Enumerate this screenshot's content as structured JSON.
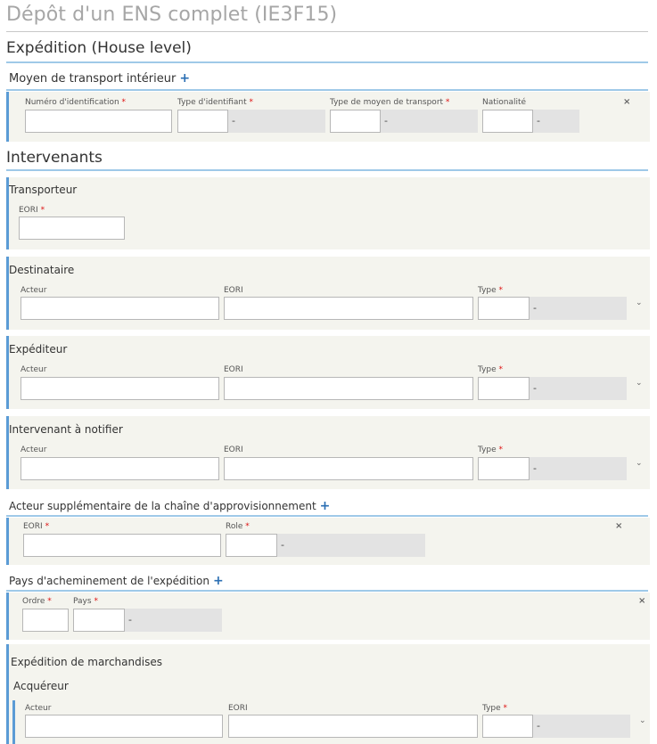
{
  "page": {
    "title": "Dépôt d'un ENS complet (IE3F15)"
  },
  "expedition": {
    "title": "Expédition (House level)",
    "transport": {
      "title": "Moyen de transport intérieur",
      "add": "+",
      "labels": {
        "numero": "Numéro d'identification",
        "type_id": "Type d'identifiant",
        "type_moyen": "Type de moyen de transport",
        "nationalite": "Nationalité"
      },
      "dash": "-",
      "close": "×"
    }
  },
  "intervenants": {
    "title": "Intervenants",
    "transporteur": {
      "title": "Transporteur",
      "eori_label": "EORI"
    },
    "destinataire": {
      "title": "Destinataire",
      "acteur": "Acteur",
      "eori": "EORI",
      "type": "Type",
      "dash": "-"
    },
    "expediteur": {
      "title": "Expéditeur",
      "acteur": "Acteur",
      "eori": "EORI",
      "type": "Type",
      "dash": "-"
    },
    "notifier": {
      "title": "Intervenant à notifier",
      "acteur": "Acteur",
      "eori": "EORI",
      "type": "Type",
      "dash": "-"
    }
  },
  "acteur_supp": {
    "title": "Acteur supplémentaire de la chaîne d'approvisionnement",
    "add": "+",
    "eori": "EORI",
    "role": "Role",
    "dash": "-",
    "close": "×"
  },
  "pays": {
    "title": "Pays d'acheminement de l'expédition",
    "add": "+",
    "ordre": "Ordre",
    "pays": "Pays",
    "dash": "-",
    "close": "×"
  },
  "marchandises": {
    "title": "Expédition de marchandises",
    "acquereur": {
      "title": "Acquéreur",
      "acteur": "Acteur",
      "eori": "EORI",
      "type": "Type",
      "dash": "-"
    }
  },
  "required_mark": "*",
  "chevron": "⌄"
}
